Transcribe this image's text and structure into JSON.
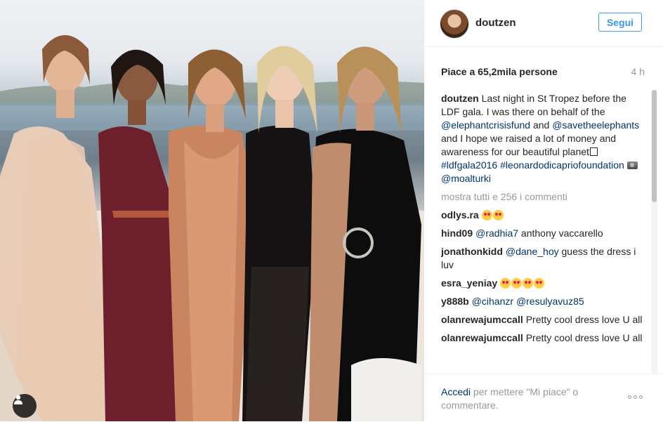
{
  "photo": {
    "alt": ""
  },
  "header": {
    "username": "doutzen",
    "follow_label": "Segui"
  },
  "post": {
    "likes": "Piace a 65,2mila persone",
    "time": "4 h",
    "caption": {
      "author": "doutzen",
      "text_1": "Last night in St Tropez before the LDF gala. I was there on behalf of the ",
      "link_1": "@elephantcrisisfund",
      "text_2": " and ",
      "link_2": "@savetheelephants",
      "text_3": " and I hope we raised a lot of money and awareness for our beautiful planet",
      "text_4": " ",
      "link_3": "#ldfgala2016",
      "text_5": " ",
      "link_4": "#leonardodicapriofoundation",
      "text_6": " ",
      "link_5": "@moalturki"
    },
    "show_all_comments": "mostra tutti e 256 i commenti"
  },
  "comments": [
    {
      "author": "odlys.ra",
      "text": "",
      "emoji_count": 2
    },
    {
      "author": "hind09",
      "mention": "@radhia7",
      "text": " anthony vaccarello"
    },
    {
      "author": "jonathonkidd",
      "mention": "@dane_hoy",
      "text": " guess the dress i luv"
    },
    {
      "author": "esra_yeniay",
      "text": "",
      "emoji_count": 4
    },
    {
      "author": "y888b",
      "mention": "@cihanzr",
      "mention_2": "@resulyavuz85"
    },
    {
      "author": "olanrewajumccall",
      "text": "Pretty cool dress love U all"
    },
    {
      "author": "olanrewajumccall",
      "text": "Pretty cool dress love U all"
    }
  ],
  "footer": {
    "login_link": "Accedi",
    "login_text": " per mettere \"Mi piace\" o commentare."
  },
  "colors": {
    "accent": "#3897f0",
    "link": "#003569",
    "muted": "#999999",
    "text": "#262626"
  },
  "icons": [
    "user-tag-icon",
    "more-options-icon"
  ]
}
